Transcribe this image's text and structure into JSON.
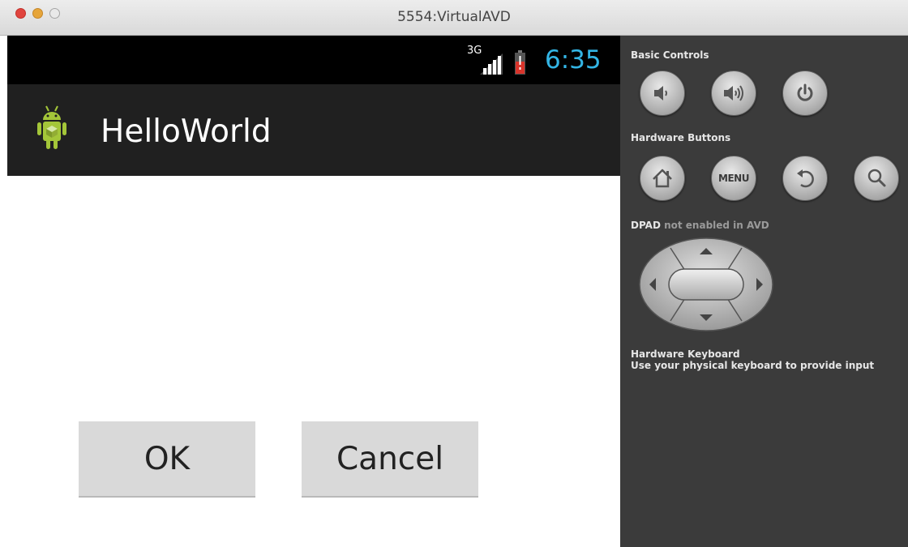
{
  "window": {
    "title": "5554:VirtualAVD"
  },
  "status_bar": {
    "network_type": "3G",
    "time": "6:35"
  },
  "action_bar": {
    "app_title": "HelloWorld",
    "app_icon": "android-robot-icon"
  },
  "buttons": {
    "ok_label": "OK",
    "cancel_label": "Cancel"
  },
  "controls": {
    "basic_controls_label": "Basic Controls",
    "basic_controls": [
      "volume-down-icon",
      "volume-up-icon",
      "power-icon"
    ],
    "hardware_buttons_label": "Hardware Buttons",
    "hardware_buttons": [
      "home-icon",
      "menu",
      "back-icon",
      "search-icon"
    ],
    "menu_label": "MENU",
    "dpad_label": "DPAD",
    "dpad_status": "not enabled in AVD",
    "keyboard_title": "Hardware Keyboard",
    "keyboard_note": "Use your physical keyboard to provide input"
  },
  "colors": {
    "clock": "#33b5e5",
    "action_bar": "#202020",
    "panel": "#3b3b3b",
    "battery_alert": "#d9342b",
    "android_green": "#a4c639"
  }
}
